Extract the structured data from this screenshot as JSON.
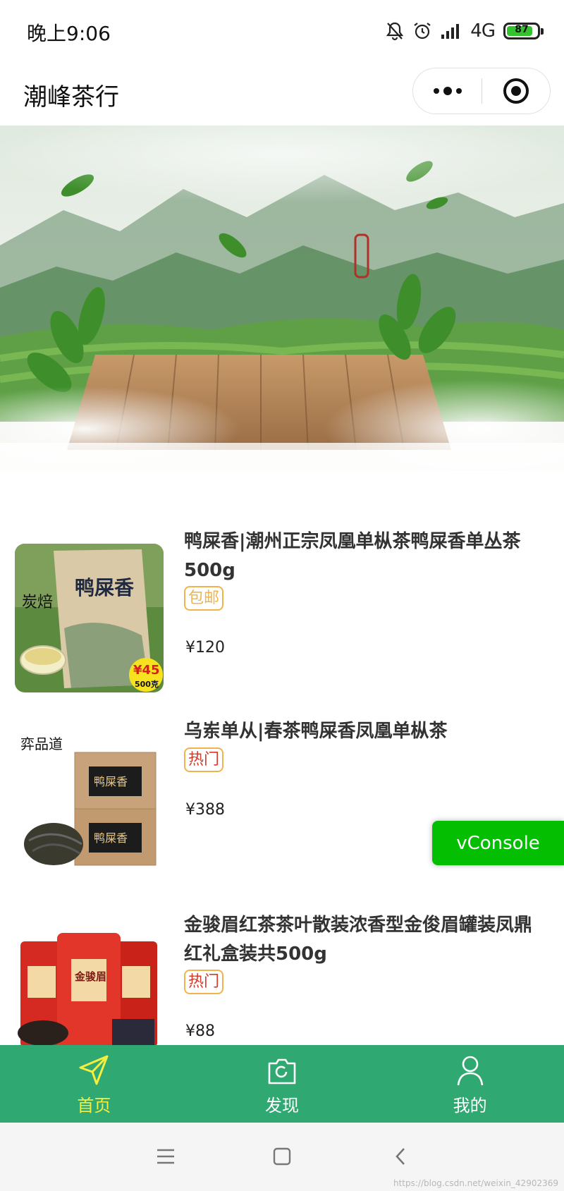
{
  "status_bar": {
    "time": "晚上9:06",
    "network": "4G",
    "battery": "87",
    "battery_level": 0.87
  },
  "nav_bar": {
    "title": "潮峰茶行"
  },
  "products": [
    {
      "title": "鸭屎香|潮州正宗凤凰单枞茶鸭屎香单丛茶500g",
      "tag": "包邮",
      "tag_color": "#f0b44c",
      "price": "¥120",
      "image_text": {
        "brand": "炭焙",
        "name": "鸭屎香",
        "badge_price": "¥45",
        "badge_weight": "500克"
      }
    },
    {
      "title": "乌岽单从|春茶鸭屎香凤凰单枞茶",
      "tag": "热门",
      "tag_color": "#d43a2a",
      "price": "¥388",
      "image_text": {
        "brand": "弈品道",
        "box_label": "鸭屎香"
      }
    },
    {
      "title": "金骏眉红茶茶叶散装浓香型金俊眉罐装凤鼎红礼盒装共500g",
      "tag": "热门",
      "tag_color": "#d43a2a",
      "price": "¥88",
      "image_text": {
        "can_label": "金骏眉"
      }
    }
  ],
  "vconsole": {
    "label": "vConsole"
  },
  "tab_bar": {
    "items": [
      {
        "label": "首页",
        "icon": "send-icon"
      },
      {
        "label": "发现",
        "icon": "camera-icon"
      },
      {
        "label": "我的",
        "icon": "user-icon"
      }
    ]
  },
  "colors": {
    "tab_bar_bg": "#2fa871",
    "tab_active": "#f6ee3f",
    "vconsole": "#04be02"
  },
  "watermark": "https://blog.csdn.net/weixin_42902369"
}
